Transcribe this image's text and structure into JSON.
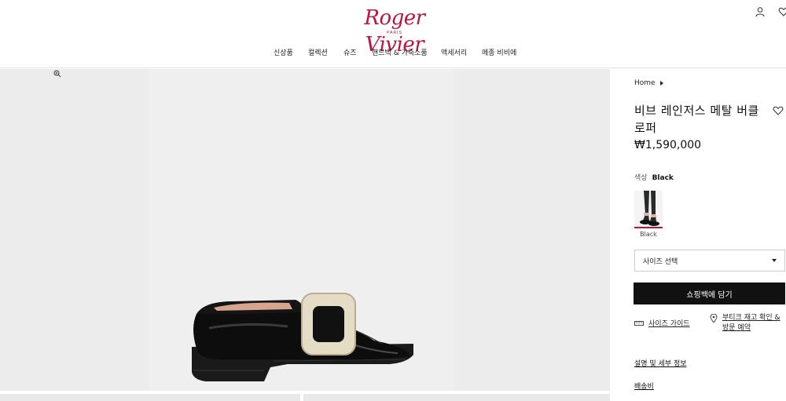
{
  "brand": {
    "logo_text": "Roger Vivier",
    "logo_sub": "PARIS",
    "color": "#b8153f"
  },
  "header_icons": [
    "user-icon",
    "heart-icon"
  ],
  "nav": {
    "items": [
      {
        "label": "신상품"
      },
      {
        "label": "컬렉션"
      },
      {
        "label": "슈즈"
      },
      {
        "label": "핸드백 & 가죽소품"
      },
      {
        "label": "액세서리"
      },
      {
        "label": "메종 비비에"
      }
    ]
  },
  "gallery": {
    "zoom_icon": "zoom-in-icon",
    "image": "shoe-loafer-black"
  },
  "product": {
    "breadcrumb": "Home",
    "title": "비브 레인저스 메탈 버클 로퍼",
    "price": "₩1,590,000",
    "color_label": "색상",
    "color_value": "Black",
    "swatch_label": "Black",
    "size_placeholder": "사이즈 선택",
    "add_to_bag": "쇼핑백에 담기",
    "size_guide": "사이즈 가이드",
    "store_stock": "부티크 재고 확인 & 방문 예약",
    "accordion": [
      "설명 및 세부 정보",
      "배송비"
    ]
  }
}
